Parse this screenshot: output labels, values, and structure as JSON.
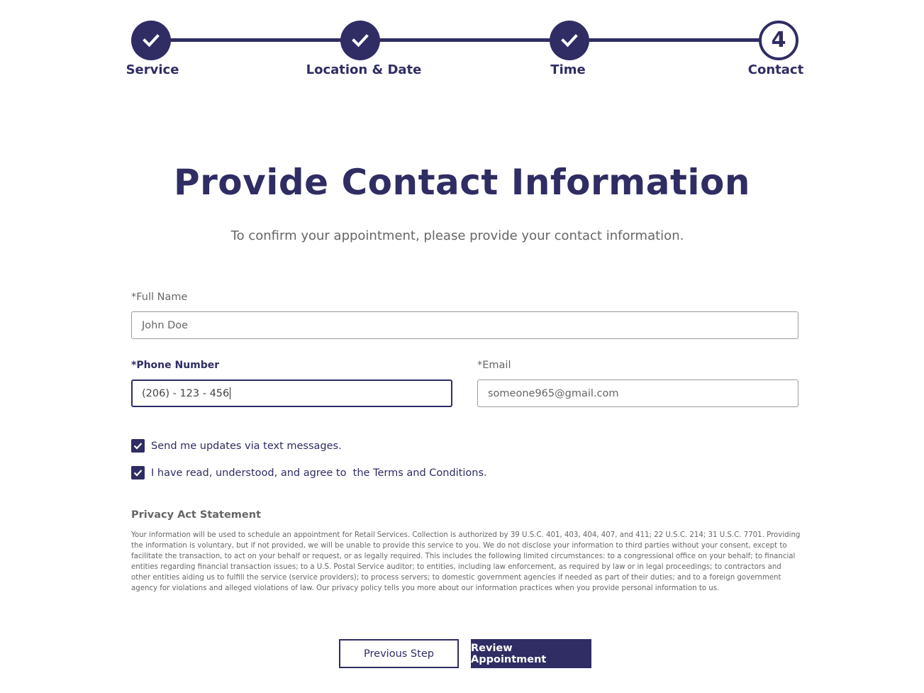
{
  "stepper": {
    "steps": [
      {
        "label": "Service",
        "status": "completed",
        "icon": "check-icon"
      },
      {
        "label": "Location & Date",
        "status": "completed",
        "icon": "check-icon"
      },
      {
        "label": "Time",
        "status": "completed",
        "icon": "check-icon"
      },
      {
        "label": "Contact",
        "status": "current",
        "number": "4"
      }
    ]
  },
  "header": {
    "title": "Provide Contact Information",
    "subtitle": "To confirm your appointment, please provide your contact information."
  },
  "form": {
    "full_name": {
      "label": "*Full Name",
      "value": "John Doe"
    },
    "phone": {
      "label": "*Phone Number",
      "value": "(206) - 123 - 456"
    },
    "email": {
      "label": "*Email",
      "value": "someone965@gmail.com"
    },
    "checkboxes": [
      {
        "label": "Send me updates via text messages.",
        "checked": true
      },
      {
        "label": "I have read, understood, and agree to  the Terms and Conditions.",
        "checked": true
      }
    ]
  },
  "privacy": {
    "title": "Privacy Act Statement",
    "body": "Your information will be used to schedule an appointment for Retail Services. Collection is authorized by 39 U.S.C. 401, 403, 404, 407, and 411; 22 U.S.C. 214; 31 U.S.C. 7701. Providing the information is voluntary, but if not provided, we will be unable to provide this service to you. We do not disclose your information to third parties without your consent, except to facilitate the transaction, to act on your behalf or request, or as legally required. This includes the following limited circumstances: to a congressional office on your behalf; to financial entities regarding financial transaction issues; to a U.S. Postal Service auditor; to entities, including law enforcement, as required by law or in legal proceedings; to contractors and other entities aiding us to fulfill the service (service providers); to process servers; to domestic government agencies if needed as part of their duties; and to a foreign government agency for violations and alleged violations of law. Our privacy policy tells you more about our information practices when you provide personal information to us."
  },
  "actions": {
    "previous_label": "Previous Step",
    "review_label": "Review Appointment"
  },
  "colors": {
    "accent": "#2f2d63",
    "muted_text": "#666666"
  }
}
